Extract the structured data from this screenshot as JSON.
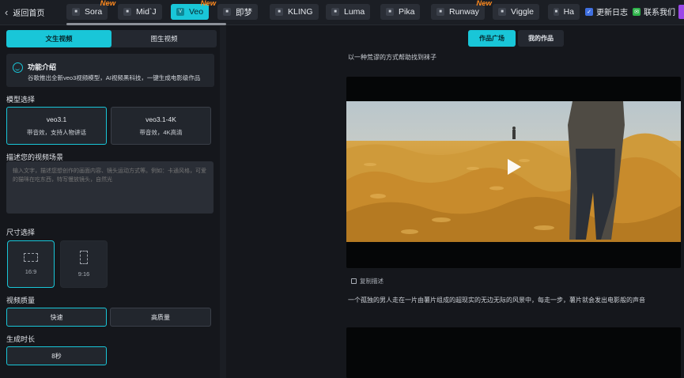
{
  "topbar": {
    "back_label": "返回首页",
    "tabs": [
      {
        "label": "Sora",
        "new": "New"
      },
      {
        "label": "Mid`J",
        "new": ""
      },
      {
        "label": "Veo",
        "new": "New",
        "active": true
      },
      {
        "label": "即梦",
        "new": ""
      },
      {
        "label": "KLING",
        "new": ""
      },
      {
        "label": "Luma",
        "new": ""
      },
      {
        "label": "Pika",
        "new": ""
      },
      {
        "label": "Runway",
        "new": "New"
      },
      {
        "label": "Viggle",
        "new": ""
      },
      {
        "label": "Ha",
        "new": ""
      }
    ],
    "changelog": "更新日志",
    "contact": "联系我们",
    "accent": "#19c6d8",
    "new_color": "#ff8a1e"
  },
  "left": {
    "mode_tabs": [
      "文生视频",
      "图生视频"
    ],
    "intro": {
      "title": "功能介绍",
      "desc": "谷歌推出全新veo3视频模型，AI视频黑科技，一键生成电影级作品"
    },
    "model_label": "模型选择",
    "models": [
      {
        "name": "veo3.1",
        "desc": "带音效，支持人物讲话"
      },
      {
        "name": "veo3.1-4K",
        "desc": "带音效，4K高清"
      }
    ],
    "describe_label": "描述您的视频场景",
    "describe_placeholder": "输入文字，描述您想创作的画面内容、镜头运动方式等。例如：卡通风格，可爱的猫咪在吃东西，特写慢放镜头，自然光",
    "size_label": "尺寸选择",
    "sizes": [
      "16:9",
      "9:16"
    ],
    "quality_label": "视频质量",
    "qualities": [
      "快速",
      "高质量"
    ],
    "duration_label": "生成时长",
    "duration": "8秒"
  },
  "right": {
    "tabs": [
      "作品广场",
      "我的作品"
    ],
    "prev_caption": "以一种荒谬的方式帮助找到袜子",
    "copy_label": "复制描述",
    "caption": "一个孤独的男人走在一片由薯片组成的超现实的无边无际的风景中，每走一步，薯片就会发出电影般的声音"
  }
}
